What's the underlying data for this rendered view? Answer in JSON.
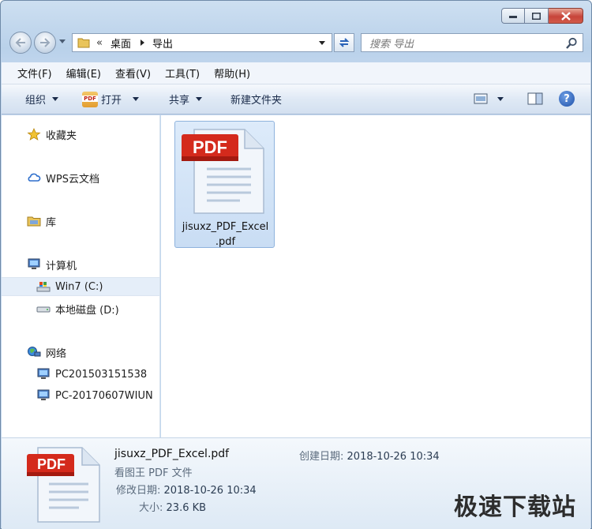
{
  "address": {
    "chevron": "«",
    "segments": [
      "桌面",
      "导出"
    ]
  },
  "search": {
    "placeholder": "搜索 导出"
  },
  "menu": [
    "文件(F)",
    "编辑(E)",
    "查看(V)",
    "工具(T)",
    "帮助(H)"
  ],
  "toolbar": {
    "organize": "组织",
    "open": "打开",
    "share": "共享",
    "new_folder": "新建文件夹",
    "help": "?"
  },
  "nav": {
    "favorites": "收藏夹",
    "wps": "WPS云文档",
    "library": "库",
    "computer": "计算机",
    "drive_c": "Win7 (C:)",
    "drive_d": "本地磁盘 (D:)",
    "network": "网络",
    "pc1": "PC201503151538",
    "pc2": "PC-20170607WIUN"
  },
  "file": {
    "badge": "PDF",
    "name_line1": "jisuxz_PDF_Excel",
    "name_line2": ".pdf"
  },
  "details": {
    "badge": "PDF",
    "name": "jisuxz_PDF_Excel.pdf",
    "type": "看图王 PDF 文件",
    "modified_label": "修改日期:",
    "modified_value": "2018-10-26 10:34",
    "size_label": "大小:",
    "size_value": "23.6 KB",
    "created_label": "创建日期:",
    "created_value": "2018-10-26 10:34"
  },
  "watermark": "极速下载站",
  "colors": {
    "pdf_red": "#d42a1c",
    "selection": "#cfe0f5",
    "window_chrome": "#c3d7ee"
  }
}
